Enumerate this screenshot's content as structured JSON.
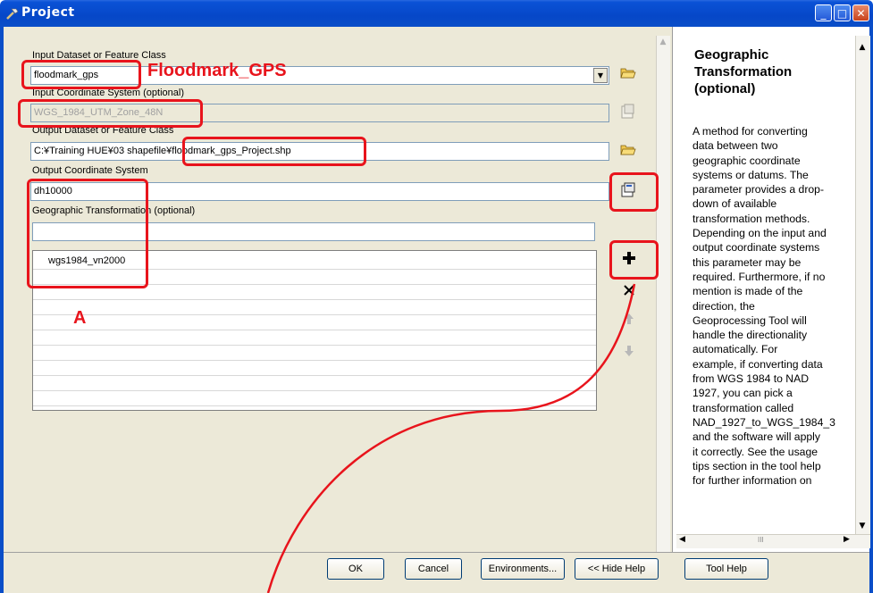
{
  "window": {
    "title": "Project",
    "title_icon": "hammer-icon",
    "minimize_glyph": "_",
    "maximize_glyph": "□",
    "close_glyph": "✕"
  },
  "form": {
    "input_dataset_label": "Input Dataset or Feature Class",
    "input_dataset_value": "floodmark_gps",
    "input_coord_label": "Input Coordinate System (optional)",
    "input_coord_value": "WGS_1984_UTM_Zone_48N",
    "output_dataset_label": "Output Dataset or Feature Class",
    "output_dataset_value": "C:¥Training HUE¥03 shapefile¥floodmark_gps_Project.shp",
    "output_coord_label": "Output Coordinate System",
    "output_coord_value": "dh10000",
    "geo_transform_label": "Geographic Transformation (optional)",
    "geo_transform_value": "",
    "transform_list": [
      "wgs1984_vn2000"
    ]
  },
  "annotations": {
    "floodmark_label": "Floodmark_GPS",
    "a_label": "A"
  },
  "help": {
    "title_lines": [
      "Geographic",
      "Transformation",
      "(optional)"
    ],
    "body_lines": [
      "A method for converting",
      "data between two",
      "geographic coordinate",
      "systems or datums. The",
      "parameter provides a drop-",
      "down of available",
      "transformation methods.",
      "Depending on the input and",
      "output coordinate systems",
      "this parameter may be",
      "required. Furthermore, if no",
      "mention is made of the",
      "direction, the",
      "Geoprocessing Tool will",
      "handle the directionality",
      "automatically. For",
      "example, if converting data",
      "from WGS 1984 to NAD",
      "1927, you can pick a",
      "transformation called",
      "NAD_1927_to_WGS_1984_3",
      "and the software will apply",
      "it correctly. See the usage",
      "tips section in the tool help",
      "for further information on"
    ],
    "hscroll_thumb": "III"
  },
  "buttons": {
    "ok": "OK",
    "cancel": "Cancel",
    "environments": "Environments...",
    "hide_help": "<< Hide Help",
    "tool_help": "Tool Help"
  },
  "colors": {
    "annotation_red": "#e8141c",
    "titlebar_blue": "#0a52d6"
  }
}
